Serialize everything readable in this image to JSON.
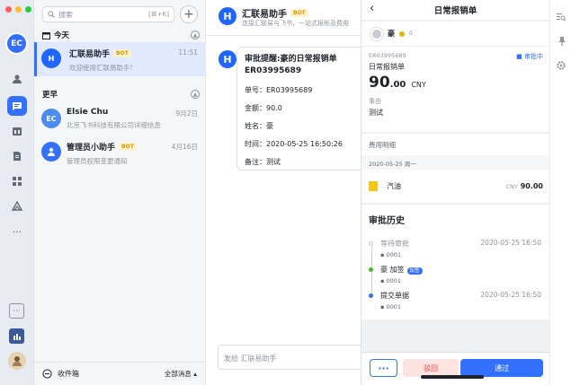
{
  "rail": {
    "avatar_initials": "EC",
    "icons": [
      "contacts-icon",
      "chat-icon",
      "calendar-icon",
      "docs-icon",
      "apps-icon",
      "workplace-icon",
      "more-icon"
    ]
  },
  "list": {
    "search_placeholder": "搜索",
    "search_shortcut": "[⌘+K]",
    "today_label": "今天",
    "earlier_label": "更早",
    "chats": [
      {
        "name": "汇联易助手",
        "bot": "BOT",
        "preview": "欢迎使用汇联易助手!",
        "time": "11:51"
      },
      {
        "name": "Elsie Chu",
        "initials": "EC",
        "preview": "北京飞书科技有限公司详细信息",
        "time": "9月2日"
      },
      {
        "name": "管理员小助手",
        "bot": "BOT",
        "preview": "管理员权限变更通知",
        "time": "4月16日"
      }
    ],
    "inbox_label": "收件箱",
    "all_messages_label": "全部消息"
  },
  "conversation": {
    "title": "汇联易助手",
    "bot": "BOT",
    "subtitle": "连接汇联易与飞书，一站式报账及费用",
    "card": {
      "title": "审批提醒:豪的日常报销单",
      "code": "ER03995689",
      "rows": [
        "单号：ER03995689",
        "金额：90.0",
        "姓名：豪",
        "时间：2020-05-25 16:50:26",
        "备注：测试"
      ]
    },
    "composer_placeholder": "发给 汇联易助手"
  },
  "panel": {
    "title": "日常报销单",
    "user_name": "豪",
    "level": "0",
    "doc_no": "ER03995689",
    "status": "审批中",
    "type": "日常报销单",
    "amount_int": "90",
    "amount_dec": ".00",
    "currency": "CNY",
    "reason_label": "事由",
    "reason_value": "测试",
    "fee_header": "费用明细",
    "fee_date": "2020-05-25 周一",
    "item_name": "汽油",
    "item_currency": "CNY",
    "item_amount": "90.00",
    "history_title": "审批历史",
    "steps": [
      {
        "name": "等待审批",
        "time": "2020-05-25 16:50",
        "id": "0001"
      },
      {
        "name": "豪 加签",
        "tag": "加签",
        "time": "",
        "id": "0001"
      },
      {
        "name": "提交单据",
        "time": "2020-05-25 16:50",
        "id": "0001"
      }
    ],
    "more_label": "···",
    "reject_label": "驳回",
    "approve_label": "通过"
  },
  "colors": {
    "accent": "#3370ff",
    "bot_tag": "#fff3cc",
    "reject_bg": "#fde2e2"
  }
}
